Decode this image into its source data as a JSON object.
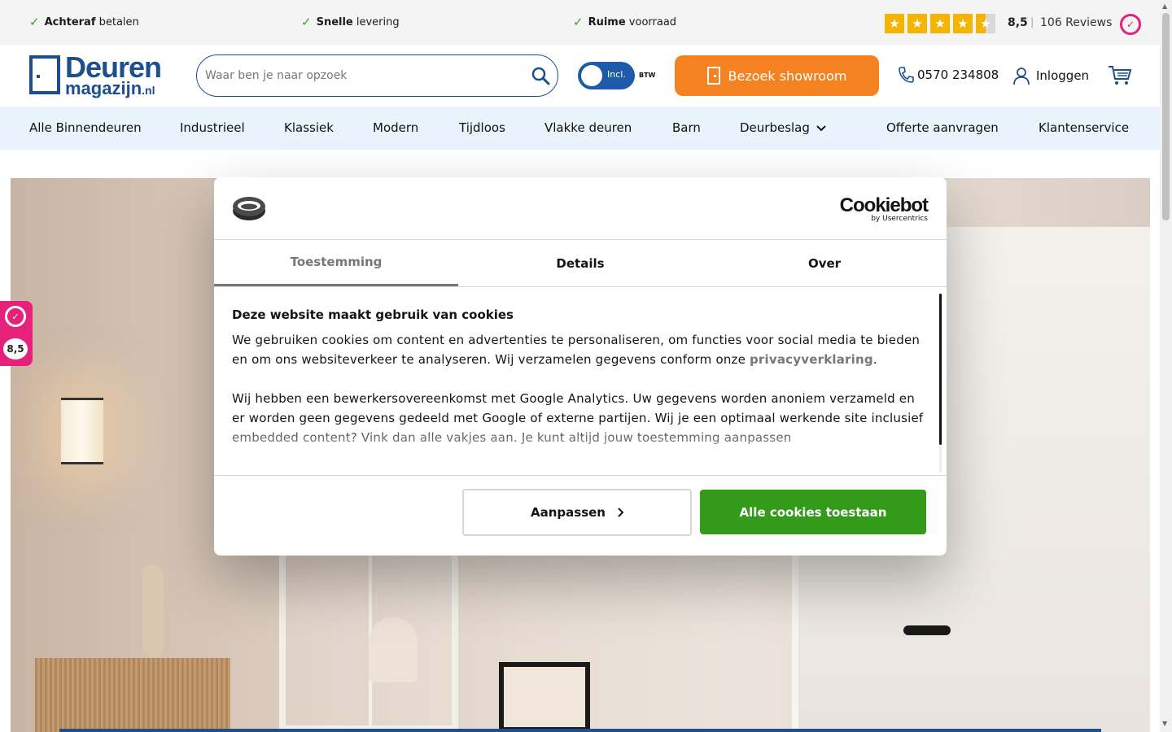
{
  "usp_bar": {
    "items": [
      {
        "bold": "Achteraf",
        "rest": " betalen"
      },
      {
        "bold": "Snelle",
        "rest": " levering"
      },
      {
        "bold": "Ruime",
        "rest": " voorraad"
      }
    ],
    "rating_score": "8,5",
    "rating_separator": "|",
    "reviews_label": "106 Reviews",
    "stars": 4.5
  },
  "header": {
    "logo_big": "Deuren",
    "logo_small": "magazijn",
    "logo_tld": ".nl",
    "search_placeholder": "Waar ben je naar opzoek",
    "vat_toggle_label": "Incl.",
    "vat_label": "BTW",
    "showroom_label": "Bezoek showroom",
    "phone": "0570 234808",
    "login_label": "Inloggen"
  },
  "nav": {
    "items": [
      "Alle Binnendeuren",
      "Industrieel",
      "Klassiek",
      "Modern",
      "Tijdloos",
      "Vlakke deuren",
      "Barn",
      "Deurbeslag",
      "Offerte aanvragen",
      "Klantenservice"
    ]
  },
  "side_widget": {
    "score": "8,5"
  },
  "cookie_dialog": {
    "brand": "Cookiebot",
    "brand_sub": "by Usercentrics",
    "tabs": [
      "Toestemming",
      "Details",
      "Over"
    ],
    "active_tab": "Toestemming",
    "title": "Deze website maakt gebruik van cookies",
    "para1_a": "We gebruiken cookies om content en advertenties te personaliseren, om functies voor social media te bieden en om ons websiteverkeer te analyseren. Wij verzamelen gegevens conform onze ",
    "para1_link": "privacyverklaring",
    "para1_b": ".",
    "para2": "Wij hebben een bewerkersovereenkomst met Google Analytics. Uw gegevens worden anoniem verzameld en er worden geen gegevens gedeeld met Google of externe partijen. Wij je een optimaal werkende site inclusief embedded content? Vink dan alle vakjes aan. Je kunt altijd jouw toestemming aanpassen",
    "btn_adjust": "Aanpassen",
    "btn_allow": "Alle cookies toestaan"
  },
  "colors": {
    "brand_blue": "#1d4f8c",
    "toggle_blue": "#1d5aa8",
    "showroom_orange": "#f58220",
    "nav_bg": "#eaf3fb",
    "allow_green": "#339a1a",
    "kiyoh_pink": "#e5217c",
    "star_yellow": "#f5b400"
  },
  "icons": [
    "check-icon",
    "star-icon",
    "kiyoh-icon",
    "search-icon",
    "door-icon",
    "phone-icon",
    "user-icon",
    "cart-icon",
    "chevron-down-icon",
    "chevron-right-icon",
    "cookie-icon"
  ]
}
